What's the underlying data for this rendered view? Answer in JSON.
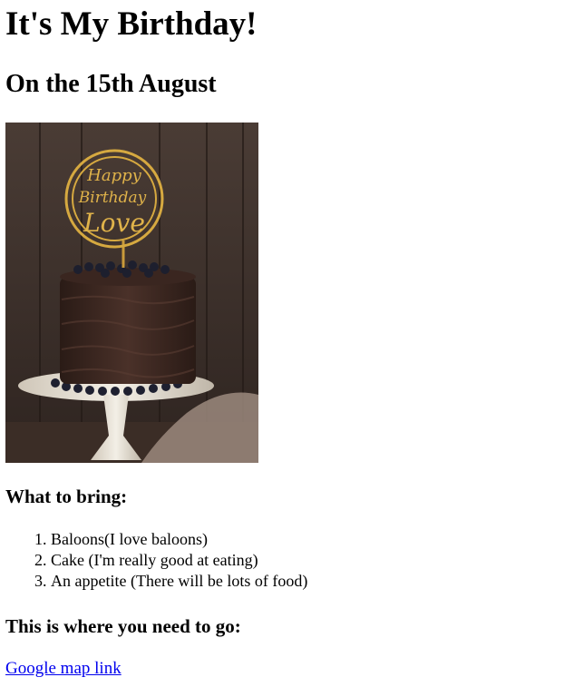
{
  "page": {
    "title": "It's My Birthday!",
    "subtitle": "On the 15th August"
  },
  "image": {
    "topper_text": [
      "Happy",
      "Birthday",
      "Love"
    ]
  },
  "bring": {
    "heading": "What to bring:",
    "items": [
      "Baloons(I love baloons)",
      "Cake (I'm really good at eating)",
      "An appetite (There will be lots of food)"
    ]
  },
  "location": {
    "heading": "This is where you need to go:",
    "link_label": "Google map link"
  },
  "colors": {
    "link": "#0000ee",
    "text": "#000000",
    "background": "#ffffff"
  }
}
